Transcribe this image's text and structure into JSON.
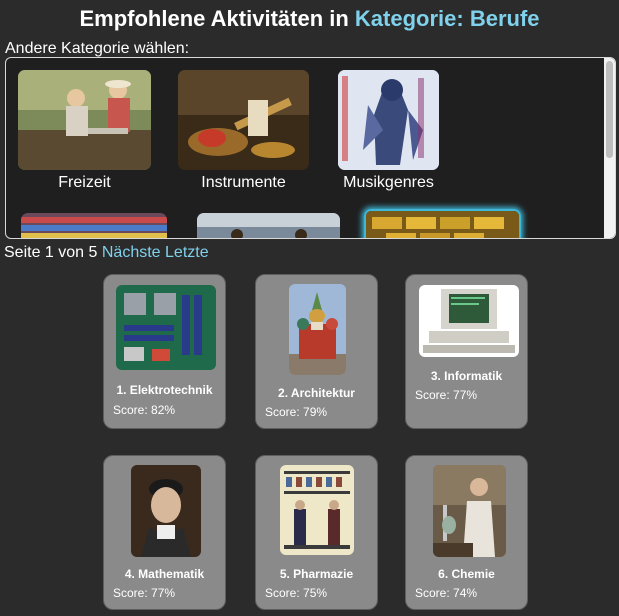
{
  "header": {
    "title_prefix": "Empfohlene Aktivitäten in",
    "title_accent": "Kategorie: Berufe"
  },
  "category_picker": {
    "label": "Andere Kategorie wählen:",
    "categories": [
      {
        "label": "Freizeit"
      },
      {
        "label": "Instrumente"
      },
      {
        "label": "Musikgenres"
      }
    ]
  },
  "pagination": {
    "text": "Seite 1 von 5",
    "next": "Nächste",
    "last": "Letzte"
  },
  "results": [
    {
      "title": "1. Elektrotechnik",
      "score": "Score: 82%"
    },
    {
      "title": "2. Architektur",
      "score": "Score: 79%"
    },
    {
      "title": "3. Informatik",
      "score": "Score: 77%"
    },
    {
      "title": "4. Mathematik",
      "score": "Score: 77%"
    },
    {
      "title": "5. Pharmazie",
      "score": "Score: 75%"
    },
    {
      "title": "6. Chemie",
      "score": "Score: 74%"
    }
  ],
  "colors": {
    "background": "#2b2b2b",
    "accent": "#7fd1ec",
    "card": "#8a8a8a"
  }
}
